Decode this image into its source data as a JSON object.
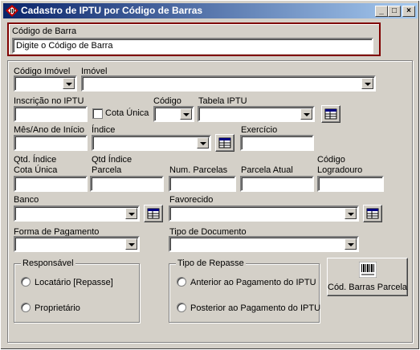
{
  "window": {
    "title": "Cadastro de IPTU por Código de Barras"
  },
  "title_buttons": {
    "minimize": "_",
    "maximize": "□",
    "close": "×"
  },
  "barcode_section": {
    "label": "Código de Barra",
    "value": "Digite o Código de Barra"
  },
  "fields": {
    "codigo_imovel": {
      "label": "Código Imóvel",
      "value": ""
    },
    "imovel": {
      "label": "Imóvel",
      "value": ""
    },
    "inscricao": {
      "label": "Inscrição no IPTU",
      "value": ""
    },
    "cota_unica": {
      "label": "Cota Única",
      "checked": false
    },
    "codigo": {
      "label": "Código",
      "value": ""
    },
    "tabela_iptu": {
      "label": "Tabela IPTU",
      "value": ""
    },
    "mes_ano_inicio": {
      "label": "Mês/Ano de Início",
      "value": ""
    },
    "indice": {
      "label": "Índice",
      "value": ""
    },
    "exercicio": {
      "label": "Exercício",
      "value": ""
    },
    "qtd_indice_cota_unica": {
      "label1": "Qtd. Índice",
      "label2": "Cota Única",
      "value": ""
    },
    "qtd_indice_parcela": {
      "label1": "Qtd Índice",
      "label2": "Parcela",
      "value": ""
    },
    "num_parcelas": {
      "label": "Num. Parcelas",
      "value": ""
    },
    "parcela_atual": {
      "label": "Parcela Atual",
      "value": ""
    },
    "codigo_logradouro": {
      "label1": "Código",
      "label2": "Logradouro",
      "value": ""
    },
    "banco": {
      "label": "Banco",
      "value": ""
    },
    "favorecido": {
      "label": "Favorecido",
      "value": ""
    },
    "forma_pagamento": {
      "label": "Forma de Pagamento",
      "value": ""
    },
    "tipo_documento": {
      "label": "Tipo de Documento",
      "value": ""
    }
  },
  "responsavel": {
    "title": "Responsável",
    "options": [
      "Locatário [Repasse]",
      "Proprietário"
    ]
  },
  "tipo_repasse": {
    "title": "Tipo de Repasse",
    "options": [
      "Anterior ao Pagamento do IPTU",
      "Posterior ao Pagamento do IPTU"
    ]
  },
  "cod_barras_parcela_button": {
    "label": "Cód. Barras Parcela"
  },
  "colors": {
    "titlebar_start": "#0a246a",
    "titlebar_end": "#a6caf0",
    "highlight_border": "#800000",
    "face": "#d4d0c8"
  },
  "icons": {
    "app": "barcode-app-icon",
    "lookup": "table-lookup-icon",
    "barcode": "barcode-icon"
  }
}
